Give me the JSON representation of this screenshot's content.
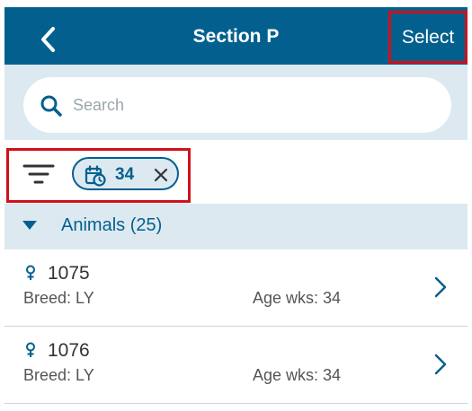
{
  "header": {
    "title": "Section P",
    "select_label": "Select",
    "back_icon": "chevron-left-icon",
    "background": "#03608e"
  },
  "search": {
    "placeholder": "Search",
    "value": "",
    "icon": "search-icon"
  },
  "filter": {
    "icon": "filter-icon",
    "chip": {
      "icon": "calendar-clock-icon",
      "value": "34",
      "remove_icon": "close-icon"
    }
  },
  "section": {
    "title": "Animals (25)",
    "expanded": true,
    "icon": "triangle-down-icon"
  },
  "animals": [
    {
      "id": "1075",
      "sex_icon": "female-icon",
      "breed": "Breed: LY",
      "age": "Age wks: 34"
    },
    {
      "id": "1076",
      "sex_icon": "female-icon",
      "breed": "Breed: LY",
      "age": "Age wks: 34"
    }
  ],
  "colors": {
    "primary": "#03608e",
    "highlight": "#d0101a",
    "section_bg": "#dce9f1"
  }
}
